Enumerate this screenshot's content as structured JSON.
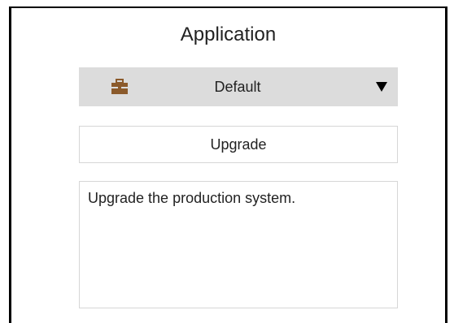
{
  "panel": {
    "title": "Application"
  },
  "profile_select": {
    "icon": "briefcase-icon",
    "selected": "Default",
    "arrow_icon": "dropdown-arrow-icon",
    "icon_color": "#8B5A2B"
  },
  "actions": {
    "upgrade_label": "Upgrade"
  },
  "description": {
    "text": "Upgrade the production system."
  }
}
